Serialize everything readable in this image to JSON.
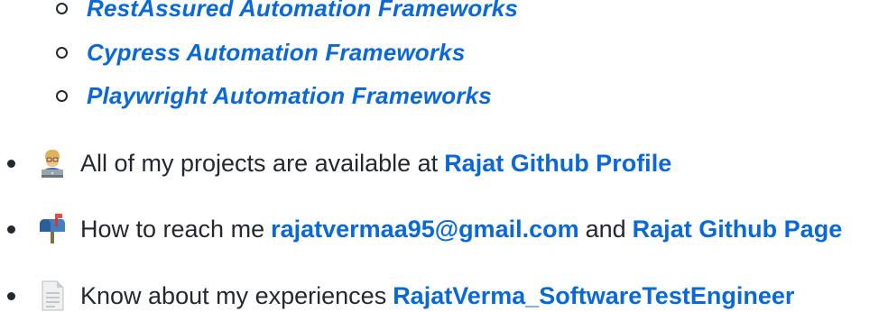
{
  "frameworks": [
    {
      "label": "RestAssured Automation Frameworks"
    },
    {
      "label": "Cypress Automation Frameworks"
    },
    {
      "label": "Playwright Automation Frameworks"
    }
  ],
  "items": {
    "projects": {
      "icon": "technologist-emoji-icon",
      "text": "All of my projects are available at",
      "link": "Rajat Github Profile"
    },
    "contact": {
      "icon": "mailbox-emoji-icon",
      "text": "How to reach me",
      "email": "rajatvermaa95@gmail.com",
      "join": "and",
      "link": "Rajat Github Page"
    },
    "experience": {
      "icon": "page-facing-up-emoji-icon",
      "text": "Know about my experiences",
      "link": "RajatVerma_SoftwareTestEngineer"
    }
  },
  "colors": {
    "link": "#0969da",
    "text": "#24292f"
  }
}
